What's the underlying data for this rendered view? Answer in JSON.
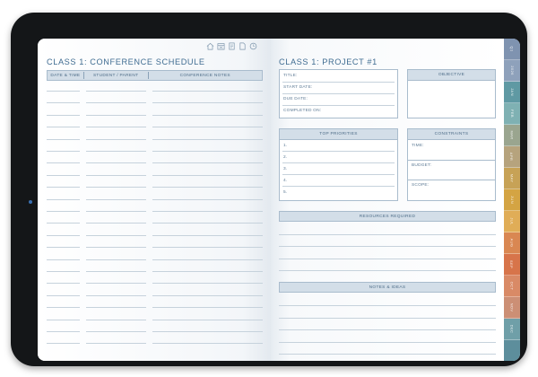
{
  "toolbar": {
    "icons": [
      "home-icon",
      "calendar-icon",
      "notes-icon",
      "document-icon",
      "clock-icon"
    ]
  },
  "left_page": {
    "title": "CLASS 1: CONFERENCE SCHEDULE",
    "columns": [
      "DATE & TIME",
      "STUDENT / PARENT",
      "CONFERENCE NOTES"
    ]
  },
  "right_page": {
    "title": "CLASS 1: PROJECT #1",
    "details": {
      "title_label": "TITLE:",
      "start_label": "START DATE:",
      "due_label": "DUE DATE:",
      "completed_label": "COMPLETED ON:"
    },
    "objective": {
      "header": "OBJECTIVE"
    },
    "priorities": {
      "header": "TOP PRIORITIES",
      "items": [
        "1.",
        "2.",
        "3.",
        "4.",
        "5."
      ]
    },
    "constraints": {
      "header": "CONSTRAINTS",
      "time_label": "TIME:",
      "budget_label": "BUDGET:",
      "scope_label": "SCOPE:"
    },
    "resources": {
      "header": "RESOURCES REQUIRED"
    },
    "notes": {
      "header": "NOTES & IDEAS"
    }
  },
  "side_tabs": [
    {
      "label": "Q1",
      "color": "#7f93b0"
    },
    {
      "label": "2026",
      "color": "#8ea1bb"
    },
    {
      "label": "JAN",
      "color": "#5f99a3"
    },
    {
      "label": "FEB",
      "color": "#7fb1b3"
    },
    {
      "label": "MAR",
      "color": "#9aa58f"
    },
    {
      "label": "APR",
      "color": "#b6a37d"
    },
    {
      "label": "MAY",
      "color": "#c7a256"
    },
    {
      "label": "JUN",
      "color": "#d4a443"
    },
    {
      "label": "JUL",
      "color": "#e0ad57"
    },
    {
      "label": "AUG",
      "color": "#d98752"
    },
    {
      "label": "SEP",
      "color": "#d7744a"
    },
    {
      "label": "OCT",
      "color": "#d98a66"
    },
    {
      "label": "NOV",
      "color": "#cc8f75"
    },
    {
      "label": "DEC",
      "color": "#6f9fa8"
    },
    {
      "label": "",
      "color": "#5d8e9c"
    }
  ]
}
